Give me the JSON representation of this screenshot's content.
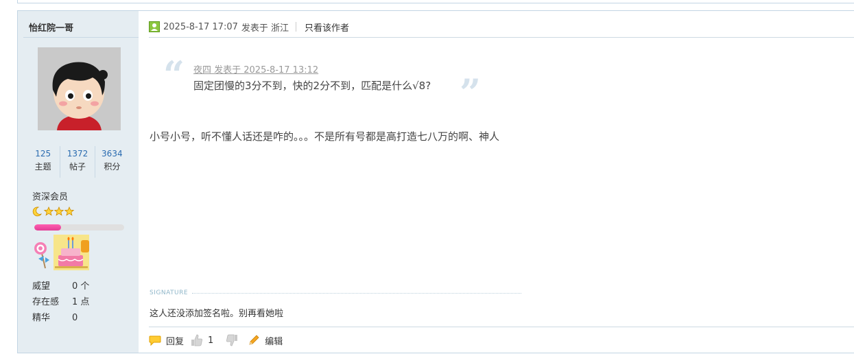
{
  "author": {
    "name": "怡红院一哥",
    "stats": [
      {
        "value": "125",
        "label": "主题"
      },
      {
        "value": "1372",
        "label": "帖子"
      },
      {
        "value": "3634",
        "label": "积分"
      }
    ],
    "group": "资深会员",
    "stars_icon": "moon-star-star-star-icon",
    "level_progress": 0.3,
    "medals": [
      "lollipop-medal-icon",
      "birthday-cake-medal-icon"
    ],
    "info": [
      {
        "label": "威望",
        "value": "0 个"
      },
      {
        "label": "存在感",
        "value": "1 点"
      },
      {
        "label": "精华",
        "value": "0"
      }
    ]
  },
  "post": {
    "meta": {
      "datetime": "2025-8-17 17:07",
      "posted_in": "发表于 浙江",
      "author_only": "只看该作者"
    },
    "quote": {
      "source": "夜四 发表于 2025-8-17 13:12",
      "text": "固定团慢的3分不到，快的2分不到，匹配是什么√8?"
    },
    "message": "小号小号，听不懂人话还是咋的。。。不是所有号都是高打造七八万的啊、神人",
    "signature_label": "SIGNATURE",
    "signature": "这人还没添加签名啦。别再看她啦",
    "actions": {
      "reply": "回复",
      "like_count": "1",
      "edit": "编辑"
    }
  },
  "colors": {
    "sidebar_bg": "#e5edf2",
    "border": "#c2d5e3",
    "link_blue": "#2a6bb0",
    "progress_pink": "#e33d96"
  }
}
